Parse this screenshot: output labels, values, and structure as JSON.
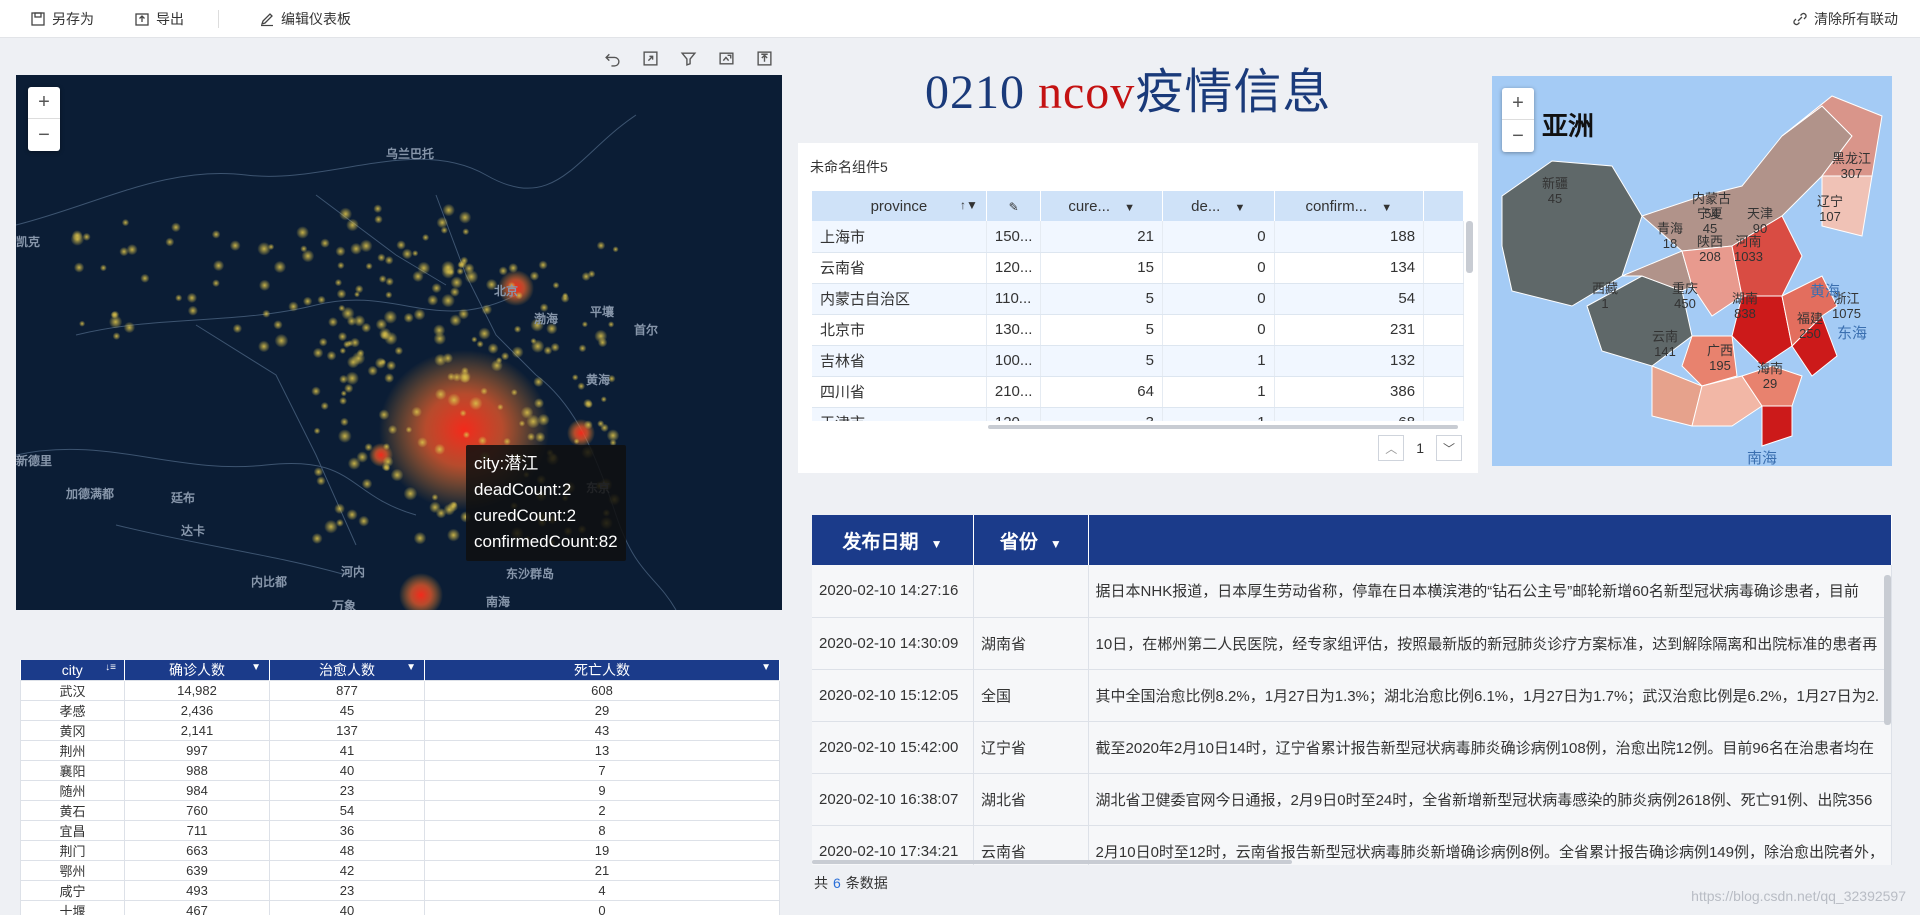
{
  "toolbar": {
    "save_as": "另存为",
    "export": "导出",
    "edit_dashboard": "编辑仪表板",
    "clear_linkage": "清除所有联动"
  },
  "title": {
    "part1": "0210",
    "part2": "ncov",
    "part3": "疫情信息"
  },
  "darkmap": {
    "labels": [
      "乌兰巴托",
      "凯克",
      "北京",
      "渤海",
      "平壤",
      "首尔",
      "黄海",
      "新德里",
      "加德满都",
      "廷布",
      "达卡",
      "内比都",
      "河内",
      "万象",
      "东京",
      "东沙群岛",
      "南海"
    ],
    "tooltip": {
      "city": "city:潜江",
      "dead": "deadCount:2",
      "cured": "curedCount:2",
      "confirmed": "confirmedCount:82"
    }
  },
  "city_table": {
    "headers": [
      "city",
      "确诊人数",
      "治愈人数",
      "死亡人数"
    ],
    "rows": [
      [
        "武汉",
        "14,982",
        "877",
        "608"
      ],
      [
        "孝感",
        "2,436",
        "45",
        "29"
      ],
      [
        "黄冈",
        "2,141",
        "137",
        "43"
      ],
      [
        "荆州",
        "997",
        "41",
        "13"
      ],
      [
        "襄阳",
        "988",
        "40",
        "7"
      ],
      [
        "随州",
        "984",
        "23",
        "9"
      ],
      [
        "黄石",
        "760",
        "54",
        "2"
      ],
      [
        "宜昌",
        "711",
        "36",
        "8"
      ],
      [
        "荆门",
        "663",
        "48",
        "19"
      ],
      [
        "鄂州",
        "639",
        "42",
        "21"
      ],
      [
        "咸宁",
        "493",
        "23",
        "4"
      ],
      [
        "十堰",
        "467",
        "40",
        "0"
      ]
    ]
  },
  "prov_panel": {
    "name": "未命名组件5",
    "headers": [
      "province",
      "",
      "cure...",
      "de...",
      "confirm..."
    ],
    "rows": [
      [
        "上海市",
        "150...",
        "21",
        "0",
        "188"
      ],
      [
        "云南省",
        "120...",
        "15",
        "0",
        "134"
      ],
      [
        "内蒙古自治区",
        "110...",
        "5",
        "0",
        "54"
      ],
      [
        "北京市",
        "130...",
        "5",
        "0",
        "231"
      ],
      [
        "吉林省",
        "100...",
        "5",
        "1",
        "132"
      ],
      [
        "四川省",
        "210...",
        "64",
        "1",
        "386"
      ],
      [
        "天津市",
        "120...",
        "3",
        "1",
        "68"
      ]
    ],
    "page": "1"
  },
  "asia_map": {
    "title": "亚洲",
    "provinces": [
      {
        "name": "黑龙江",
        "value": "307"
      },
      {
        "name": "新疆",
        "value": "45"
      },
      {
        "name": "内蒙古",
        "value": "54"
      },
      {
        "name": "辽宁",
        "value": "107"
      },
      {
        "name": "宁夏",
        "value": "45"
      },
      {
        "name": "天津",
        "value": "90"
      },
      {
        "name": "青海",
        "value": "18"
      },
      {
        "name": "陕西",
        "value": "208"
      },
      {
        "name": "河南",
        "value": "1033"
      },
      {
        "name": "西藏",
        "value": "1"
      },
      {
        "name": "重庆",
        "value": "450"
      },
      {
        "name": "湖南",
        "value": "838"
      },
      {
        "name": "浙江",
        "value": "1075"
      },
      {
        "name": "福建",
        "value": "250"
      },
      {
        "name": "云南",
        "value": "141"
      },
      {
        "name": "广西",
        "value": "195"
      },
      {
        "name": "海南",
        "value": "29"
      }
    ],
    "sea_labels": [
      "黄海",
      "东海",
      "南海"
    ]
  },
  "news": {
    "headers": [
      "发布日期",
      "省份",
      ""
    ],
    "rows": [
      [
        "2020-02-10 14:27:16",
        "",
        "据日本NHK报道，日本厚生劳动省称，停靠在日本横滨港的“钻石公主号”邮轮新增60名新型冠状病毒确诊患者，目前"
      ],
      [
        "2020-02-10 14:30:09",
        "湖南省",
        "10日，在郴州第二人民医院，经专家组评估，按照最新版的新冠肺炎诊疗方案标准，达到解除隔离和出院标准的患者再"
      ],
      [
        "2020-02-10 15:12:05",
        "全国",
        "其中全国治愈比例8.2%，1月27日为1.3%；湖北治愈比例6.1%，1月27日为1.7%；武汉治愈比例是6.2%，1月27日为2."
      ],
      [
        "2020-02-10 15:42:00",
        "辽宁省",
        "截至2020年2月10日14时，辽宁省累计报告新型冠状病毒肺炎确诊病例108例，治愈出院12例。目前96名在治患者均在"
      ],
      [
        "2020-02-10 16:38:07",
        "湖北省",
        "湖北省卫健委官网今日通报，2月9日0时至24时，全省新增新型冠状病毒感染的肺炎病例2618例、死亡91例、出院356"
      ],
      [
        "2020-02-10 17:34:21",
        "云南省",
        "2月10日0时至12时，云南省报告新型冠状病毒肺炎新增确诊病例8例。全省累计报告确诊病例149例，除治愈出院者外，"
      ]
    ],
    "footer_prefix": "共",
    "footer_count": "6",
    "footer_suffix": "条数据"
  },
  "watermark": "https://blog.csdn.net/qq_32392597"
}
